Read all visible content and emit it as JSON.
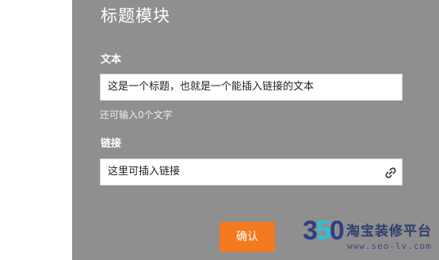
{
  "module": {
    "title": "标题模块",
    "text_label": "文本",
    "text_value": "这是一个标题，也就是一个能插入链接的文本",
    "hint": "还可输入0个文字",
    "link_label": "链接",
    "link_placeholder": "这里可插入链接",
    "link_icon": "link-icon",
    "confirm_label": "确认"
  },
  "watermark": {
    "digit1": "3",
    "digit2": "5",
    "digit3": "0",
    "name": "淘宝装修平台",
    "url": "www.seo-lv.com"
  },
  "colors": {
    "panel_bg": "#8f8f8f",
    "accent": "#f47a20"
  }
}
